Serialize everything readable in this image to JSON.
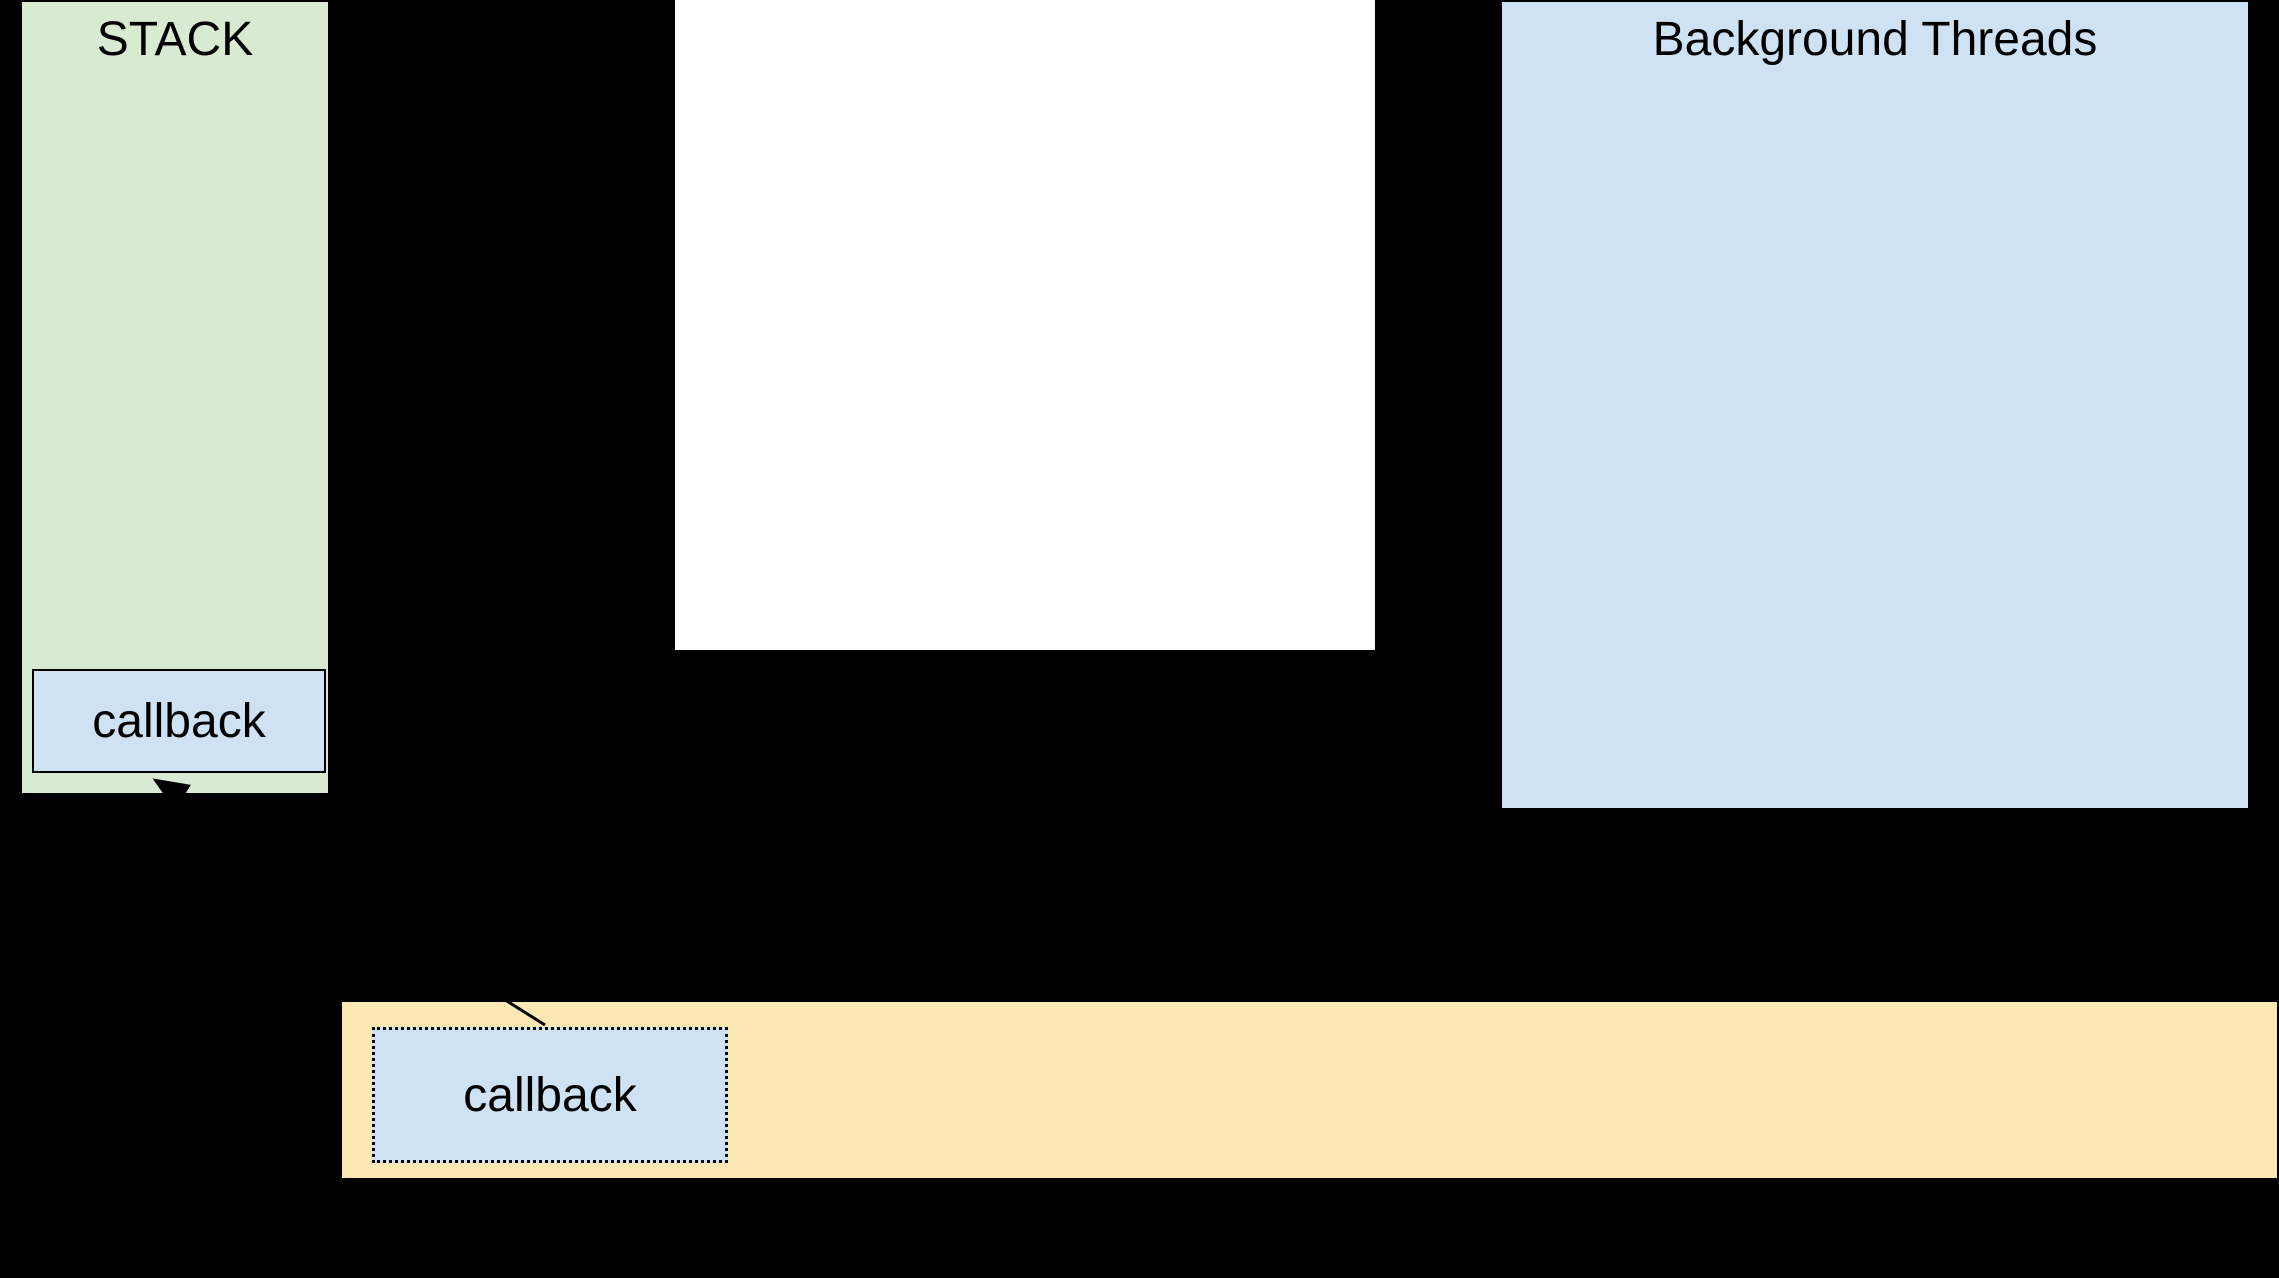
{
  "stack": {
    "title": "STACK",
    "callback_label": "callback"
  },
  "background_threads": {
    "title": "Background Threads"
  },
  "queue": {
    "callback_label": "callback"
  },
  "colors": {
    "stack_bg": "#d9ead3",
    "threads_bg": "#cfe2f3",
    "queue_bg": "#fce8b2",
    "callback_bg": "#cfe2f3"
  }
}
